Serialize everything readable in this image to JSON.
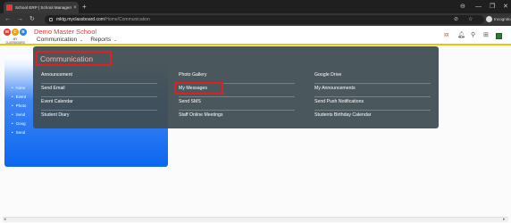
{
  "browser": {
    "tab_title": "School ERP | School Management",
    "tab_close": "×",
    "new_tab": "+",
    "window_buttons": [
      "⊖",
      "—",
      "❐",
      "✕"
    ],
    "nav": [
      "←",
      "→",
      "↻"
    ],
    "url_host": "mktg.myclassboard.com",
    "url_path": "/Home/Communication",
    "address_icons": [
      "⊘",
      "☆"
    ],
    "profile_label": "Incognito"
  },
  "header": {
    "logo_letters": [
      "M",
      "C",
      "B"
    ],
    "logo_text": "MY CLASSBOARD",
    "school_name": "Demo Master School",
    "nav": [
      {
        "label": "Communication",
        "chevron": "⌄"
      },
      {
        "label": "Reports",
        "chevron": "⌄"
      }
    ],
    "right_icons": [
      "flag-icon",
      "bell-icon",
      "search-icon",
      "grid-icon",
      "square-icon"
    ],
    "right_glyphs": [
      "𝍊",
      "🔔︎",
      "⚲",
      "⊞",
      ""
    ]
  },
  "page": {
    "left_list": [
      "Anno",
      "Event",
      "Photo",
      "Send",
      "Goog",
      "Send"
    ]
  },
  "mega_menu": {
    "title": "Communication",
    "columns": [
      [
        "Announcement",
        "Send Email",
        "Event Calendar",
        "Student Diary"
      ],
      [
        "Photo Gallery",
        "My Messages",
        "Send SMS",
        "Staff Online Meetings"
      ],
      [
        "Google Drive",
        "My Announcements",
        "Send Push Notifications",
        "Students Birthday Calendar"
      ]
    ]
  },
  "colors": {
    "brand_red": "#e53935",
    "accent_yellow": "#f2c200",
    "menu_bg": "#404e54",
    "highlight": "#e02020",
    "card_blue": "#0b66f0"
  }
}
